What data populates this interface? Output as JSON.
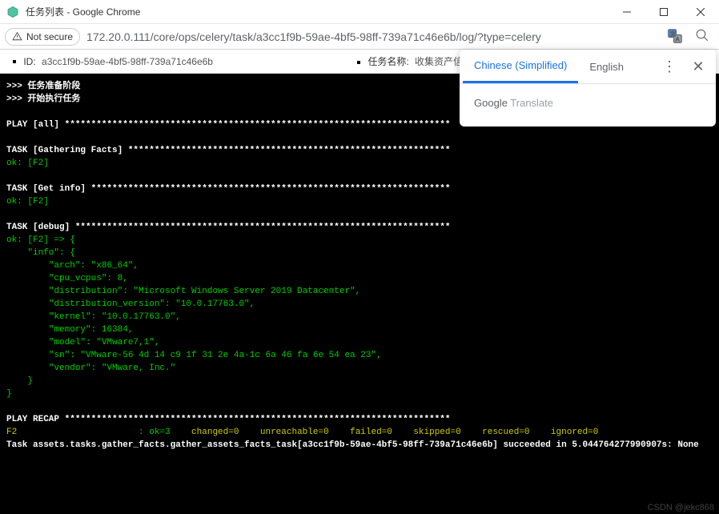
{
  "window": {
    "title": "任务列表 - Google Chrome"
  },
  "address": {
    "not_secure": "Not secure",
    "url": "172.20.0.111/core/ops/celery/task/a3cc1f9b-59ae-4bf5-98ff-739a71c46e6b/log/?type=celery"
  },
  "info": {
    "id_label": "ID:",
    "id_value": "a3cc1f9b-59ae-4bf5-98ff-739a71c46e6b",
    "name_label": "任务名称:",
    "name_value": "收集资产信息"
  },
  "terminal": {
    "prep": ">>> 任务准备阶段",
    "start": ">>> 开始执行任务",
    "play_all": "PLAY [all] *************************************************************************",
    "t_gather": "TASK [Gathering Facts] *************************************************************",
    "ok1": "ok: [F2]",
    "t_get": "TASK [Get info] ********************************************************************",
    "ok2": "ok: [F2]",
    "t_debug": "TASK [debug] ***********************************************************************",
    "d0": "ok: [F2] => {",
    "d1": "    \"info\": {",
    "d2": "        \"arch\": \"x86_64\",",
    "d3": "        \"cpu_vcpus\": 8,",
    "d4": "        \"distribution\": \"Microsoft Windows Server 2019 Datacenter\",",
    "d5": "        \"distribution_version\": \"10.0.17763.0\",",
    "d6": "        \"kernel\": \"10.0.17763.0\",",
    "d7": "        \"memory\": 16384,",
    "d8": "        \"model\": \"VMware7,1\",",
    "d9": "        \"sn\": \"VMware-56 4d 14 c9 1f 31 2e 4a-1c 6a 46 fa 6e 54 ea 23\",",
    "d10": "        \"vendor\": \"VMware, Inc.\"",
    "d11": "    }",
    "d12": "}",
    "recap": "PLAY RECAP *************************************************************************",
    "recap_host": "F2",
    "recap_ok": ": ok=3   ",
    "recap_rest": " changed=0    unreachable=0    failed=0    skipped=0    rescued=0    ignored=0",
    "final": "Task assets.tasks.gather_facts.gather_assets_facts_task[a3cc1f9b-59ae-4bf5-98ff-739a71c46e6b] succeeded in 5.044764277990907s: None"
  },
  "translate": {
    "tab_zh": "Chinese (Simplified)",
    "tab_en": "English",
    "brand_google": "Google",
    "brand_translate": " Translate"
  },
  "watermark": "CSDN @jekc868"
}
